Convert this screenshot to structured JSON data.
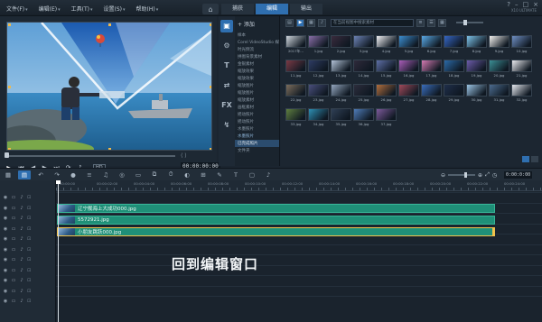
{
  "menu": {
    "items": [
      {
        "label": "文件(F)"
      },
      {
        "label": "编辑(E)"
      },
      {
        "label": "工具(T)"
      },
      {
        "label": "设置(S)"
      },
      {
        "label": "帮助(H)"
      }
    ],
    "product_label": "X10 ULTIMATE"
  },
  "tabs": [
    {
      "label": "捕获"
    },
    {
      "label": "编辑",
      "active": true
    },
    {
      "label": "输出"
    }
  ],
  "library": {
    "add_label": "+ 添加",
    "search_placeholder": "在当前视图中搜索素材",
    "folders": [
      {
        "label": "样本"
      },
      {
        "label": "Corel VideoStudio 媒体"
      },
      {
        "label": "时光倒流"
      },
      {
        "label": "拼图背景素材"
      },
      {
        "label": "金银素材"
      },
      {
        "label": "缩放效果"
      },
      {
        "label": "缩放效果"
      },
      {
        "label": "缩放图片"
      },
      {
        "label": "缩放图片"
      },
      {
        "label": "缩放素材"
      },
      {
        "label": "画框素材"
      },
      {
        "label": "摇动照片"
      },
      {
        "label": "摇动照片"
      },
      {
        "label": "水墨照片"
      },
      {
        "label": "水墨照片",
        "blue": true
      },
      {
        "label": "已完成照片",
        "active": true
      },
      {
        "label": "文件夹"
      }
    ],
    "thumbs": [
      {
        "cap": "2017年...",
        "color": "#cfd6dd"
      },
      {
        "cap": "1.jpg",
        "color": "#8a6fa8"
      },
      {
        "cap": "2.jpg",
        "color": "#3a2b3d"
      },
      {
        "cap": "3.jpg",
        "color": "#6d83b5"
      },
      {
        "cap": "4.jpg",
        "color": "#f2f2f5"
      },
      {
        "cap": "5.jpg",
        "color": "#3c8ed0"
      },
      {
        "cap": "6.jpg",
        "color": "#5aa9e6"
      },
      {
        "cap": "7.jpg",
        "color": "#3566c4"
      },
      {
        "cap": "8.jpg",
        "color": "#7ec3e9"
      },
      {
        "cap": "9.jpg",
        "color": "#f4f2ef"
      },
      {
        "cap": "10.jpg",
        "color": "#6f8fc2"
      },
      {
        "cap": "11.jpg",
        "color": "#7b3a45"
      },
      {
        "cap": "12.jpg",
        "color": "#2d3b63"
      },
      {
        "cap": "13.jpg",
        "color": "#b3c3d8"
      },
      {
        "cap": "14.jpg",
        "color": "#2f2a3b"
      },
      {
        "cap": "15.jpg",
        "color": "#5e6fa7"
      },
      {
        "cap": "16.jpg",
        "color": "#a95db8"
      },
      {
        "cap": "17.jpg",
        "color": "#d47ab2"
      },
      {
        "cap": "18.jpg",
        "color": "#2b6aa8"
      },
      {
        "cap": "19.jpg",
        "color": "#6c5ba9"
      },
      {
        "cap": "20.jpg",
        "color": "#3b8f95"
      },
      {
        "cap": "21.jpg",
        "color": "#ececf0"
      },
      {
        "cap": "22.jpg",
        "color": "#7c6d5c"
      },
      {
        "cap": "23.jpg",
        "color": "#4a4f7c"
      },
      {
        "cap": "24.jpg",
        "color": "#93a5bd"
      },
      {
        "cap": "25.jpg",
        "color": "#2c2d3c"
      },
      {
        "cap": "26.jpg",
        "color": "#b16e3d"
      },
      {
        "cap": "27.jpg",
        "color": "#a04a5a"
      },
      {
        "cap": "28.jpg",
        "color": "#3a6dbb"
      },
      {
        "cap": "29.jpg",
        "color": "#1f2e4a"
      },
      {
        "cap": "30.jpg",
        "color": "#9bc4e4"
      },
      {
        "cap": "31.jpg",
        "color": "#4c6b8e"
      },
      {
        "cap": "32.jpg",
        "color": "#e5e8ee"
      },
      {
        "cap": "33.jpg",
        "color": "#5f7f3f"
      },
      {
        "cap": "34.jpg",
        "color": "#2d8fb4"
      },
      {
        "cap": "35.jpg",
        "color": "#2f3f55"
      },
      {
        "cap": "36.jpg",
        "color": "#4f7cb9"
      },
      {
        "cap": "37.jpg",
        "color": "#7e5a9b"
      }
    ]
  },
  "preview": {
    "timecode": "00:00:00:00",
    "hd_label": "HD"
  },
  "timeline": {
    "time": "0:00:0:00",
    "ruler_labels": [
      "00:00:00",
      "00:00:02:00",
      "00:00:04:00",
      "00:00:06:00",
      "00:00:08:00",
      "00:00:10:00",
      "00:00:12:00",
      "00:00:14:00",
      "00:00:16:00",
      "00:00:18:00",
      "00:00:20:00",
      "00:00:22:00",
      "00:00:24:00"
    ],
    "clips": [
      {
        "name": "辽宁舰海上大成功000.jpg",
        "selected": false
      },
      {
        "name": "5572921.jpg",
        "selected": false
      },
      {
        "name": "小朋友跳跃000.jpg",
        "selected": true
      }
    ],
    "overlay_text": "回到编辑窗口"
  },
  "colors": {
    "accent": "#2f6fb0",
    "clip": "#1f8f78",
    "clip_selected_border": "#f2c24b"
  }
}
